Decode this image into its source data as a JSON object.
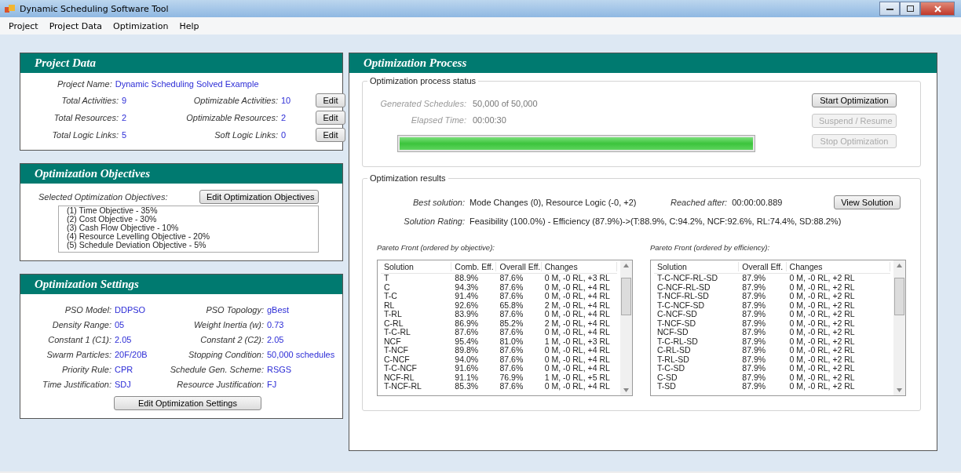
{
  "window": {
    "title": "Dynamic Scheduling Software Tool"
  },
  "menu": [
    "Project",
    "Project Data",
    "Optimization",
    "Help"
  ],
  "project_data": {
    "title": "Project Data",
    "name_label": "Project Name:",
    "name_value": "Dynamic Scheduling Solved Example",
    "rows": [
      {
        "left_label": "Total Activities:",
        "left_value": "9",
        "right_label": "Optimizable Activities:",
        "right_value": "10",
        "button": "Edit"
      },
      {
        "left_label": "Total Resources:",
        "left_value": "2",
        "right_label": "Optimizable Resources:",
        "right_value": "2",
        "button": "Edit"
      },
      {
        "left_label": "Total Logic Links:",
        "left_value": "5",
        "right_label": "Soft Logic Links:",
        "right_value": "0",
        "button": "Edit"
      }
    ]
  },
  "objectives": {
    "title": "Optimization Objectives",
    "label": "Selected Optimization Objectives:",
    "button": "Edit Optimization Objectives",
    "items": [
      "(1) Time Objective - 35%",
      "(2) Cost Objective - 30%",
      "(3) Cash Flow Objective - 10%",
      "(4) Resource Levelling Objective - 20%",
      "(5) Schedule Deviation Objective - 5%"
    ]
  },
  "settings": {
    "title": "Optimization Settings",
    "button": "Edit Optimization Settings",
    "rows": [
      {
        "left_label": "PSO Model:",
        "left_value": "DDPSO",
        "right_label": "PSO Topology:",
        "right_value": "gBest"
      },
      {
        "left_label": "Density Range:",
        "left_value": "05",
        "right_label": "Weight Inertia (w):",
        "right_value": "0.73"
      },
      {
        "left_label": "Constant 1 (C1):",
        "left_value": "2.05",
        "right_label": "Constant 2 (C2):",
        "right_value": "2.05"
      },
      {
        "left_label": "Swarm Particles:",
        "left_value": "20F/20B",
        "right_label": "Stopping Condition:",
        "right_value": "50,000 schedules"
      },
      {
        "left_label": "Priority Rule:",
        "left_value": "CPR",
        "right_label": "Schedule Gen. Scheme:",
        "right_value": "RSGS"
      },
      {
        "left_label": "Time Justification:",
        "left_value": "SDJ",
        "right_label": "Resource Justification:",
        "right_value": "FJ"
      }
    ]
  },
  "process": {
    "title": "Optimization Process",
    "status": {
      "title": "Optimization process status",
      "fields": [
        {
          "label": "Generated Schedules:",
          "value": "50,000 of 50,000"
        },
        {
          "label": "Elapsed Time:",
          "value": "00:00:30"
        }
      ],
      "progress": {
        "level": 1.0
      },
      "buttons": [
        {
          "label": "Start Optimization",
          "disabled": false
        },
        {
          "label": "Suspend / Resume",
          "disabled": true
        },
        {
          "label": "Stop Optimization",
          "disabled": true
        }
      ]
    },
    "results": {
      "title": "Optimization results",
      "best_label": "Best solution:",
      "best_value": "Mode Changes (0), Resource Logic (-0, +2)",
      "reached_label": "Reached after:",
      "reached_value": "00:00:00.889",
      "view_button": "View Solution",
      "rating_label": "Solution Rating:",
      "rating_value": "Feasibility (100.0%)  -  Efficiency (87.9%)->(T:88.9%, C:94.2%, NCF:92.6%, RL:74.4%, SD:88.2%)",
      "tables": [
        {
          "title": "Pareto Front (ordered by objective):",
          "columns": [
            "Solution",
            "Comb. Eff.",
            "Overall Eff.",
            "Changes"
          ],
          "rows": [
            [
              "T",
              "88.9%",
              "87.6%",
              "0 M, -0 RL, +3 RL"
            ],
            [
              "C",
              "94.3%",
              "87.6%",
              "0 M, -0 RL, +4 RL"
            ],
            [
              "T-C",
              "91.4%",
              "87.6%",
              "0 M, -0 RL, +4 RL"
            ],
            [
              "RL",
              "92.6%",
              "65.8%",
              "2 M, -0 RL, +4 RL"
            ],
            [
              "T-RL",
              "83.9%",
              "87.6%",
              "0 M, -0 RL, +4 RL"
            ],
            [
              "C-RL",
              "86.9%",
              "85.2%",
              "2 M, -0 RL, +4 RL"
            ],
            [
              "T-C-RL",
              "87.6%",
              "87.6%",
              "0 M, -0 RL, +4 RL"
            ],
            [
              "NCF",
              "95.4%",
              "81.0%",
              "1 M, -0 RL, +3 RL"
            ],
            [
              "T-NCF",
              "89.8%",
              "87.6%",
              "0 M, -0 RL, +4 RL"
            ],
            [
              "C-NCF",
              "94.0%",
              "87.6%",
              "0 M, -0 RL, +4 RL"
            ],
            [
              "T-C-NCF",
              "91.6%",
              "87.6%",
              "0 M, -0 RL, +4 RL"
            ],
            [
              "NCF-RL",
              "91.1%",
              "76.9%",
              "1 M, -0 RL, +5 RL"
            ],
            [
              "T-NCF-RL",
              "85.3%",
              "87.6%",
              "0 M, -0 RL, +4 RL"
            ]
          ]
        },
        {
          "title": "Pareto Front (ordered by efficiency):",
          "columns": [
            "Solution",
            "Overall Eff.",
            "Changes"
          ],
          "rows": [
            [
              "T-C-NCF-RL-SD",
              "87.9%",
              "0 M, -0 RL, +2 RL"
            ],
            [
              "C-NCF-RL-SD",
              "87.9%",
              "0 M, -0 RL, +2 RL"
            ],
            [
              "T-NCF-RL-SD",
              "87.9%",
              "0 M, -0 RL, +2 RL"
            ],
            [
              "T-C-NCF-SD",
              "87.9%",
              "0 M, -0 RL, +2 RL"
            ],
            [
              "C-NCF-SD",
              "87.9%",
              "0 M, -0 RL, +2 RL"
            ],
            [
              "T-NCF-SD",
              "87.9%",
              "0 M, -0 RL, +2 RL"
            ],
            [
              "NCF-SD",
              "87.9%",
              "0 M, -0 RL, +2 RL"
            ],
            [
              "T-C-RL-SD",
              "87.9%",
              "0 M, -0 RL, +2 RL"
            ],
            [
              "C-RL-SD",
              "87.9%",
              "0 M, -0 RL, +2 RL"
            ],
            [
              "T-RL-SD",
              "87.9%",
              "0 M, -0 RL, +2 RL"
            ],
            [
              "T-C-SD",
              "87.9%",
              "0 M, -0 RL, +2 RL"
            ],
            [
              "C-SD",
              "87.9%",
              "0 M, -0 RL, +2 RL"
            ],
            [
              "T-SD",
              "87.9%",
              "0 M, -0 RL, +2 RL"
            ]
          ]
        }
      ]
    }
  }
}
